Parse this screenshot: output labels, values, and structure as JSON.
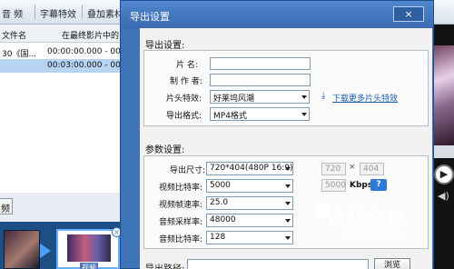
{
  "background_app": {
    "tabs": [
      "音 频",
      "字幕特效",
      "叠加素材"
    ],
    "list_headers": [
      "文件名",
      "在最终影片中的"
    ],
    "rows": [
      {
        "name": "30《国...",
        "time": "00:00:00.000 - 00:0"
      },
      {
        "name": "",
        "time": "00:03:00.000 - 00:0"
      }
    ],
    "left_button": "频",
    "thumb_caption": "视频",
    "thumb_close": "×"
  },
  "dialog": {
    "title": "导出设置",
    "close_icon": "×",
    "export_section": {
      "heading": "导出设置:",
      "name_label": "片  名:",
      "name_value": "",
      "author_label": "制 作 者:",
      "author_value": "",
      "intro_label": "片头特效:",
      "intro_value": "好莱坞风潮",
      "download_link": "下载更多片头特效",
      "format_label": "导出格式:",
      "format_value": "MP4格式"
    },
    "param_section": {
      "heading": "参数设置:",
      "size_label": "导出尺寸:",
      "size_value": "720*404(480P 16:9)",
      "width_value": "720",
      "times_sign": "×",
      "height_value": "404",
      "vbitrate_label": "视频比特率:",
      "vbitrate_value": "5000",
      "vbitrate_box": "5000",
      "vbitrate_unit": "Kbps",
      "help_label": "?",
      "framerate_label": "视频帧速率:",
      "framerate_value": "25.0",
      "samplerate_label": "音频采样率:",
      "samplerate_value": "48000",
      "abitrate_label": "音频比特率:",
      "abitrate_value": "128"
    },
    "path_label": "导出路径:",
    "path_value": "",
    "browse_label": "浏览"
  },
  "watermark": {
    "title": "百科全说",
    "subtitle": "助你轻松解决"
  }
}
